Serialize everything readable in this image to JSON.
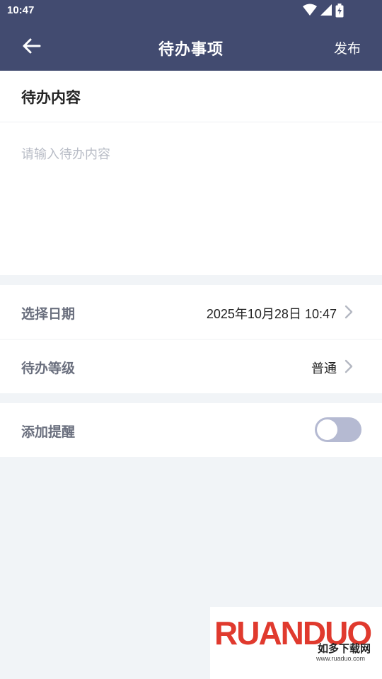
{
  "status_bar": {
    "time": "10:47",
    "icons": [
      "wifi-icon",
      "signal-icon",
      "battery-icon"
    ]
  },
  "app_bar": {
    "title": "待办事项",
    "back_icon": "arrow-left-icon",
    "publish_label": "发布",
    "background_color": "#424b70"
  },
  "content": {
    "section_title": "待办内容",
    "input_value": "",
    "input_placeholder": "请输入待办内容"
  },
  "settings": {
    "date_row": {
      "label": "选择日期",
      "value": "2025年10月28日 10:47"
    },
    "level_row": {
      "label": "待办等级",
      "value": "普通"
    }
  },
  "reminder": {
    "label": "添加提醒",
    "enabled": false
  },
  "watermark": {
    "logo_text": "RUANDUO",
    "chinese_text": "如多下载网",
    "url": "www.ruaduo.com"
  },
  "colors": {
    "accent": "#424b70",
    "page_background": "#f1f4f7",
    "toggle_off": "#b5bad2"
  }
}
